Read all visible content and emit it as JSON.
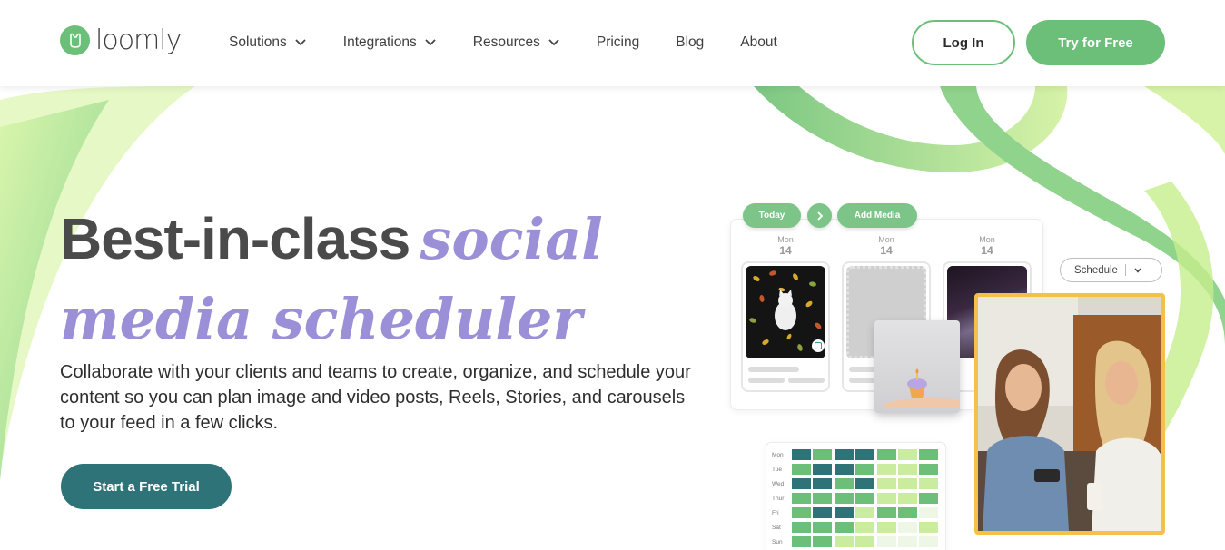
{
  "header": {
    "logo_text": "loomly",
    "nav": [
      {
        "label": "Solutions",
        "has_dropdown": true
      },
      {
        "label": "Integrations",
        "has_dropdown": true
      },
      {
        "label": "Resources",
        "has_dropdown": true
      },
      {
        "label": "Pricing",
        "has_dropdown": false
      },
      {
        "label": "Blog",
        "has_dropdown": false
      },
      {
        "label": "About",
        "has_dropdown": false
      }
    ],
    "login_label": "Log In",
    "try_label": "Try for Free"
  },
  "hero": {
    "title_plain": "Best-in-class",
    "title_accent_1": "social",
    "title_accent_2": "media scheduler",
    "description": "Collaborate with your clients and teams to create, organize, and schedule your content so you can plan image and video posts, Reels, Stories, and carousels to your feed in a few clicks.",
    "cta_label": "Start a Free Trial"
  },
  "mockup": {
    "today_label": "Today",
    "next_icon": "chevron-right-icon",
    "add_media_label": "Add Media",
    "days": [
      {
        "name": "Mon",
        "num": "14"
      },
      {
        "name": "Mon",
        "num": "14"
      },
      {
        "name": "Mon",
        "num": "14"
      }
    ],
    "schedule_label": "Schedule",
    "heatmap": {
      "rows": [
        "Mon",
        "Tue",
        "Wed",
        "Thur",
        "Fri",
        "Sat",
        "Sun"
      ]
    }
  },
  "colors": {
    "brand_green": "#6bbf78",
    "accent_purple": "#9b8fd8",
    "cta_teal": "#2e7377",
    "heat_dark": "#2e7377",
    "heat_mid": "#6bbf78",
    "heat_light": "#c9ec9f",
    "heat_pale": "#eef7e5"
  }
}
